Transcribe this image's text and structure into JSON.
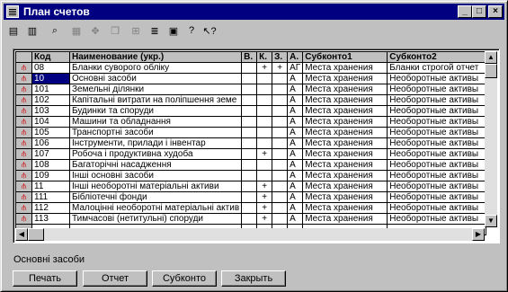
{
  "window": {
    "title": "План счетов"
  },
  "toolbar": {
    "tools": [
      {
        "icon": "new-record-icon",
        "glyph": "▤"
      },
      {
        "icon": "edit-record-icon",
        "glyph": "▥"
      },
      {
        "icon": "find-icon",
        "glyph": "⌕"
      },
      {
        "icon": "delete-icon",
        "glyph": "▦"
      },
      {
        "icon": "move-icon",
        "glyph": "✥"
      },
      {
        "icon": "copy-icon",
        "glyph": "❐"
      },
      {
        "icon": "tree-icon",
        "glyph": "⊞"
      },
      {
        "icon": "list-icon",
        "glyph": "≣"
      },
      {
        "icon": "filter-icon",
        "glyph": "▣"
      },
      {
        "icon": "help-icon",
        "glyph": "?"
      },
      {
        "icon": "context-help-icon",
        "glyph": "↖?"
      }
    ]
  },
  "grid": {
    "columns": [
      "Код",
      "Наименование (укр.)",
      "В.",
      "К.",
      "З.",
      "А.",
      "Субконто1",
      "Субконто2"
    ],
    "rows": [
      {
        "code": "08",
        "name": "Бланки суворого обліку",
        "v": "",
        "k": "+",
        "z": "+",
        "a": "АГ",
        "s1": "Места хранения",
        "s2": "Бланки строгой отчет"
      },
      {
        "code": "10",
        "name": "Основні засоби",
        "v": "",
        "k": "",
        "z": "",
        "a": "А",
        "s1": "Места хранения",
        "s2": "Необоротные активы"
      },
      {
        "code": "101",
        "name": "Земельні ділянки",
        "v": "",
        "k": "",
        "z": "",
        "a": "А",
        "s1": "Места хранения",
        "s2": "Необоротные активы"
      },
      {
        "code": "102",
        "name": "Капітальні витрати на поліпшення земе",
        "v": "",
        "k": "",
        "z": "",
        "a": "А",
        "s1": "Места хранения",
        "s2": "Необоротные активы"
      },
      {
        "code": "103",
        "name": "Будинки та споруди",
        "v": "",
        "k": "",
        "z": "",
        "a": "А",
        "s1": "Места хранения",
        "s2": "Необоротные активы"
      },
      {
        "code": "104",
        "name": "Машини та обладнання",
        "v": "",
        "k": "",
        "z": "",
        "a": "А",
        "s1": "Места хранения",
        "s2": "Необоротные активы"
      },
      {
        "code": "105",
        "name": "Транспортні засоби",
        "v": "",
        "k": "",
        "z": "",
        "a": "А",
        "s1": "Места хранения",
        "s2": "Необоротные активы"
      },
      {
        "code": "106",
        "name": "Інструменти, прилади і інвентар",
        "v": "",
        "k": "",
        "z": "",
        "a": "А",
        "s1": "Места хранения",
        "s2": "Необоротные активы"
      },
      {
        "code": "107",
        "name": "Робоча і продуктивна худоба",
        "v": "",
        "k": "+",
        "z": "",
        "a": "А",
        "s1": "Места хранения",
        "s2": "Необоротные активы"
      },
      {
        "code": "108",
        "name": "Багаторічні насадження",
        "v": "",
        "k": "",
        "z": "",
        "a": "А",
        "s1": "Места хранения",
        "s2": "Необоротные активы"
      },
      {
        "code": "109",
        "name": "Інші основні засоби",
        "v": "",
        "k": "",
        "z": "",
        "a": "А",
        "s1": "Места хранения",
        "s2": "Необоротные активы"
      },
      {
        "code": "11",
        "name": "Інші необоротні матеріальні активи",
        "v": "",
        "k": "+",
        "z": "",
        "a": "А",
        "s1": "Места хранения",
        "s2": "Необоротные активы"
      },
      {
        "code": "111",
        "name": "Бібліотечні фонди",
        "v": "",
        "k": "+",
        "z": "",
        "a": "А",
        "s1": "Места хранения",
        "s2": "Необоротные активы"
      },
      {
        "code": "112",
        "name": "Малоцінні необоротні матеріальні актив",
        "v": "",
        "k": "+",
        "z": "",
        "a": "А",
        "s1": "Места хранения",
        "s2": "Необоротные активы"
      },
      {
        "code": "113",
        "name": "Тимчасові (нетитульні) споруди",
        "v": "",
        "k": "+",
        "z": "",
        "a": "А",
        "s1": "Места хранения",
        "s2": "Необоротные активы"
      }
    ],
    "selected_row": 1
  },
  "status": {
    "text": "Основні засоби"
  },
  "buttons": {
    "print": "Печать",
    "report": "Отчет",
    "subconto": "Субконто",
    "close": "Закрыть"
  }
}
